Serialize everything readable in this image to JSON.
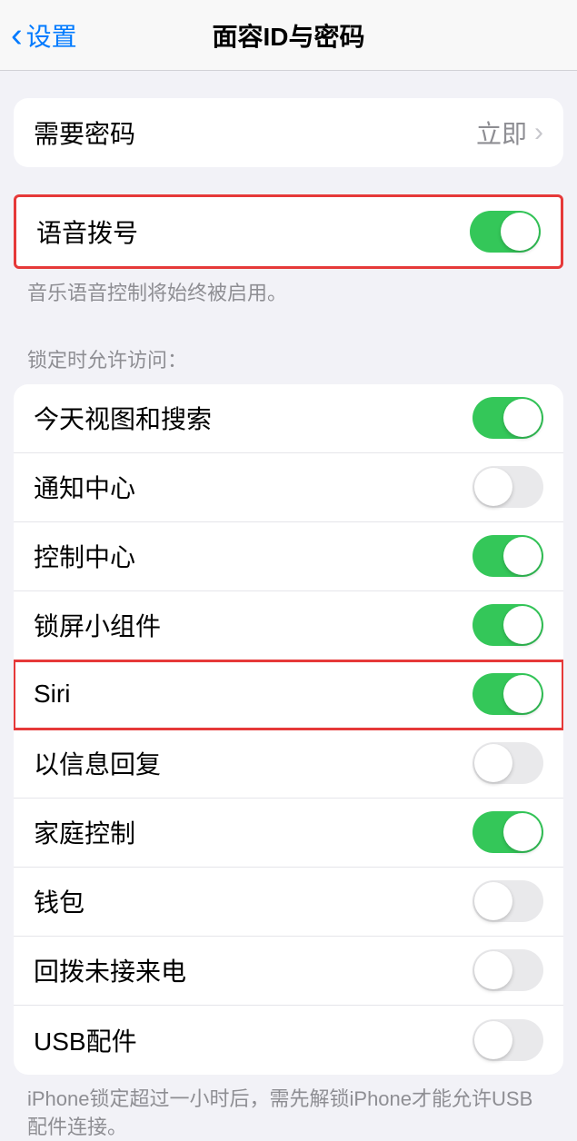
{
  "header": {
    "back_label": "设置",
    "title": "面容ID与密码"
  },
  "passcode_group": {
    "label": "需要密码",
    "value": "立即"
  },
  "voice_dial": {
    "label": "语音拨号",
    "on": true,
    "footer": "音乐语音控制将始终被启用。"
  },
  "lock_section": {
    "header": "锁定时允许访问：",
    "items": [
      {
        "label": "今天视图和搜索",
        "on": true
      },
      {
        "label": "通知中心",
        "on": false
      },
      {
        "label": "控制中心",
        "on": true
      },
      {
        "label": "锁屏小组件",
        "on": true
      },
      {
        "label": "Siri",
        "on": true
      },
      {
        "label": "以信息回复",
        "on": false
      },
      {
        "label": "家庭控制",
        "on": true
      },
      {
        "label": "钱包",
        "on": false
      },
      {
        "label": "回拨未接来电",
        "on": false
      },
      {
        "label": "USB配件",
        "on": false
      }
    ],
    "footer": "iPhone锁定超过一小时后，需先解锁iPhone才能允许USB配件连接。"
  }
}
